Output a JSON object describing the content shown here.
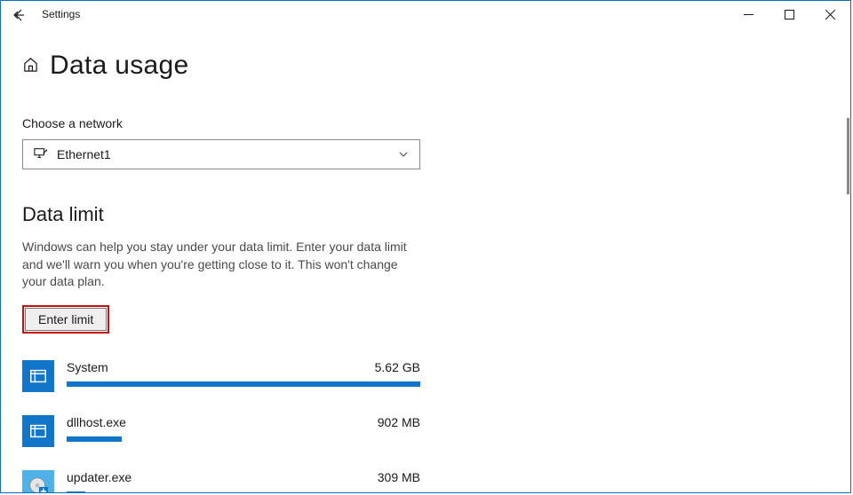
{
  "window": {
    "title": "Settings"
  },
  "page": {
    "title": "Data usage"
  },
  "network": {
    "label": "Choose a network",
    "selected": "Ethernet1"
  },
  "data_limit": {
    "heading": "Data limit",
    "description": "Windows can help you stay under your data limit. Enter your data limit and we'll warn you when you're getting close to it. This won't change your data plan.",
    "button_label": "Enter limit"
  },
  "usage": {
    "items": [
      {
        "name": "System",
        "value": "5.62 GB",
        "bar_pct": 100,
        "icon": "system"
      },
      {
        "name": "dllhost.exe",
        "value": "902 MB",
        "bar_pct": 15.7,
        "icon": "system"
      },
      {
        "name": "updater.exe",
        "value": "309 MB",
        "bar_pct": 5.4,
        "icon": "installer"
      }
    ]
  }
}
